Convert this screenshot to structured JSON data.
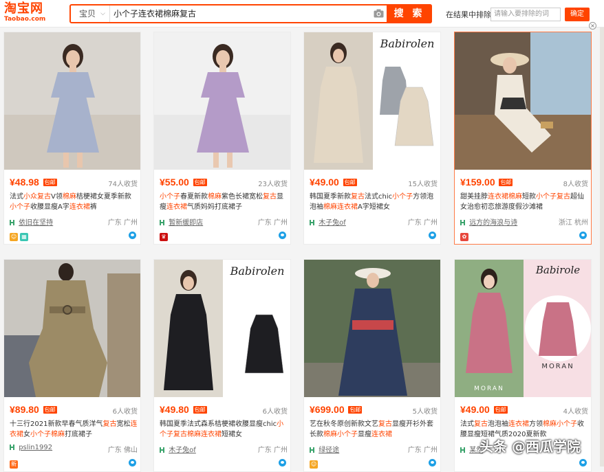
{
  "header": {
    "logo_main": "淘宝网",
    "logo_sub": "Taobao.com",
    "search_type": "宝贝",
    "search_query": "小个子连衣裙棉麻复古",
    "search_button": "搜 索",
    "exclude_label": "在结果中排除",
    "exclude_placeholder": "请输入要排除的词",
    "confirm_button": "确定",
    "close_glyph": "×"
  },
  "products": [
    {
      "price": "¥48.98",
      "tag": "包邮",
      "sales": "74人收货",
      "title_parts": [
        [
          "法式",
          0
        ],
        [
          "小众",
          1
        ],
        [
          "复古",
          1
        ],
        [
          "V领",
          0
        ],
        [
          "棉麻",
          1
        ],
        [
          "桔梗裙女夏季新款",
          0
        ],
        [
          "小个子",
          1
        ],
        [
          "收腰显瘦A字",
          0
        ],
        [
          "连衣裙",
          1
        ],
        [
          "裤",
          0
        ]
      ],
      "shop": "依旧在坚持",
      "location": "广东 广州"
    },
    {
      "price": "¥55.00",
      "tag": "包邮",
      "sales": "23人收货",
      "title_parts": [
        [
          "小个子",
          1
        ],
        [
          "春夏新款",
          0
        ],
        [
          "棉麻",
          1
        ],
        [
          "紫色长裙宽松",
          0
        ],
        [
          "复古",
          1
        ],
        [
          "显瘦",
          0
        ],
        [
          "连衣裙",
          1
        ],
        [
          "气质妈妈打底裙子",
          0
        ]
      ],
      "shop": "暂新缓即店",
      "location": "广东 广州"
    },
    {
      "price": "¥49.00",
      "tag": "包邮",
      "sales": "15人收货",
      "title_parts": [
        [
          "韩国夏季新款",
          0
        ],
        [
          "复古",
          1
        ],
        [
          "法式chic",
          0
        ],
        [
          "小个子",
          1
        ],
        [
          "方领泡泡袖",
          0
        ],
        [
          "棉麻连衣裙",
          1
        ],
        [
          "A字短裙女",
          0
        ]
      ],
      "shop": "木子兔of",
      "location": "广东 广州"
    },
    {
      "price": "¥159.00",
      "tag": "包邮",
      "sales": "8人收货",
      "title_parts": [
        [
          "甜美挂脖",
          0
        ],
        [
          "连衣裙棉麻",
          1
        ],
        [
          "短款",
          0
        ],
        [
          "小个子复古",
          1
        ],
        [
          "超仙女治愈初恋旅游度假沙滩裙",
          0
        ]
      ],
      "shop": "远方的海浪与诗",
      "location": "浙江 杭州"
    },
    {
      "price": "¥89.80",
      "tag": "包邮",
      "sales": "6人收货",
      "title_parts": [
        [
          "十三行2021新款早春气质洋气",
          0
        ],
        [
          "复古",
          1
        ],
        [
          "宽松",
          0
        ],
        [
          "连衣裙",
          1
        ],
        [
          "女",
          0
        ],
        [
          "小个子棉麻",
          1
        ],
        [
          "打底裙子",
          0
        ]
      ],
      "shop": "pslin1992",
      "location": "广东 佛山"
    },
    {
      "price": "¥49.80",
      "tag": "包邮",
      "sales": "6人收货",
      "title_parts": [
        [
          "韩国夏季法式森系桔梗裙收腰显瘦chic",
          0
        ],
        [
          "小个子复古棉麻连衣裙",
          1
        ],
        [
          "短裙女",
          0
        ]
      ],
      "shop": "木子兔of",
      "location": "广东 广州"
    },
    {
      "price": "¥699.00",
      "tag": "包邮",
      "sales": "5人收货",
      "title_parts": [
        [
          "艺在秋冬原创新款文艺",
          0
        ],
        [
          "复古",
          1
        ],
        [
          "显瘦开衫外套长款",
          0
        ],
        [
          "棉麻小个子",
          1
        ],
        [
          "显瘦",
          0
        ],
        [
          "连衣裙",
          1
        ]
      ],
      "shop": "绿径途",
      "location": "广东 广州"
    },
    {
      "price": "¥49.00",
      "tag": "包邮",
      "sales": "4人收货",
      "title_parts": [
        [
          "法式",
          0
        ],
        [
          "复古",
          1
        ],
        [
          "泡泡袖",
          0
        ],
        [
          "连衣裙",
          1
        ],
        [
          "方领",
          0
        ],
        [
          "棉麻小个子",
          1
        ],
        [
          "收腰显瘦短裙气质2020夏新款",
          0
        ]
      ],
      "shop": "某然",
      "location": ""
    }
  ],
  "watermark": "头条 @西瓜学院",
  "colors": {
    "accent": "#ff4400",
    "wangwang": "#1ea0e6"
  },
  "thumb_texts": {
    "brand": "Babirolen",
    "brand2": "Babirole",
    "moran": "MORAN"
  }
}
